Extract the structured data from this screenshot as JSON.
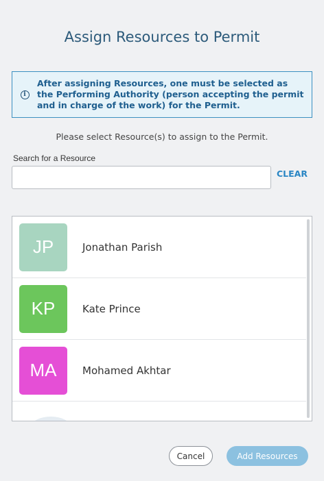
{
  "dialog": {
    "title": "Assign Resources to Permit",
    "info": {
      "icon": "info-circle-icon",
      "text": "After assigning Resources, one must be selected as the Performing Authority (person accepting the permit and in charge of the work) for the Permit."
    },
    "instruction": "Please select Resource(s) to assign to the Permit.",
    "search": {
      "label": "Search for a Resource",
      "value": "",
      "placeholder": "",
      "clear_label": "CLEAR"
    },
    "resources": [
      {
        "initials": "JP",
        "name": "Jonathan Parish",
        "color": "#a8d5c0"
      },
      {
        "initials": "KP",
        "name": "Kate Prince",
        "color": "#6cc65c"
      },
      {
        "initials": "MA",
        "name": "Mohamed Akhtar",
        "color": "#e54fd6"
      }
    ],
    "buttons": {
      "cancel": "Cancel",
      "add": "Add Resources"
    },
    "colors": {
      "accent": "#2a86c4",
      "info_border": "#3a8fc0",
      "info_background": "#e6f3f9",
      "add_button": "#8cc1e0"
    }
  }
}
